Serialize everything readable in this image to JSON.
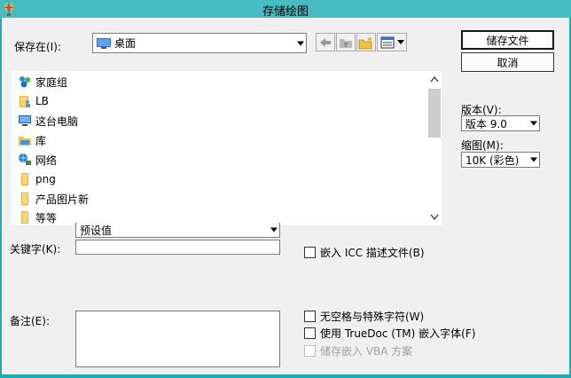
{
  "window": {
    "title": "存储绘图"
  },
  "save_in": {
    "label": "保存在(I):",
    "value": "桌面"
  },
  "files": [
    {
      "name": "家庭组",
      "icon": "homegroup-icon"
    },
    {
      "name": "LB",
      "icon": "user-folder-icon"
    },
    {
      "name": "这台电脑",
      "icon": "computer-icon"
    },
    {
      "name": "库",
      "icon": "library-icon"
    },
    {
      "name": "网络",
      "icon": "network-icon"
    },
    {
      "name": "png",
      "icon": "folder-icon"
    },
    {
      "name": "产品图片新",
      "icon": "folder-icon"
    },
    {
      "name": "等等",
      "icon": "folder-icon"
    }
  ],
  "buttons": {
    "save": "储存文件",
    "cancel": "取消"
  },
  "version": {
    "label": "版本(V):",
    "value": "版本 9.0"
  },
  "thumbnail": {
    "label": "缩图(M):",
    "value": "10K (彩色)"
  },
  "partial_combo": {
    "value": "预设值"
  },
  "keywords": {
    "label": "关键字(K):",
    "value": ""
  },
  "notes": {
    "label": "备注(E):",
    "value": ""
  },
  "options": {
    "embed_icc": "嵌入 ICC 描述文件(B)",
    "no_spaces": "无空格与特殊字符(W)",
    "truedoc": "使用 TrueDoc (TM) 嵌入字体(F)",
    "vba": "储存嵌入 VBA 方案"
  },
  "colors": {
    "titlebar": "#46bcc2",
    "border": "#24a9ae",
    "client": "#f0f0f0"
  }
}
